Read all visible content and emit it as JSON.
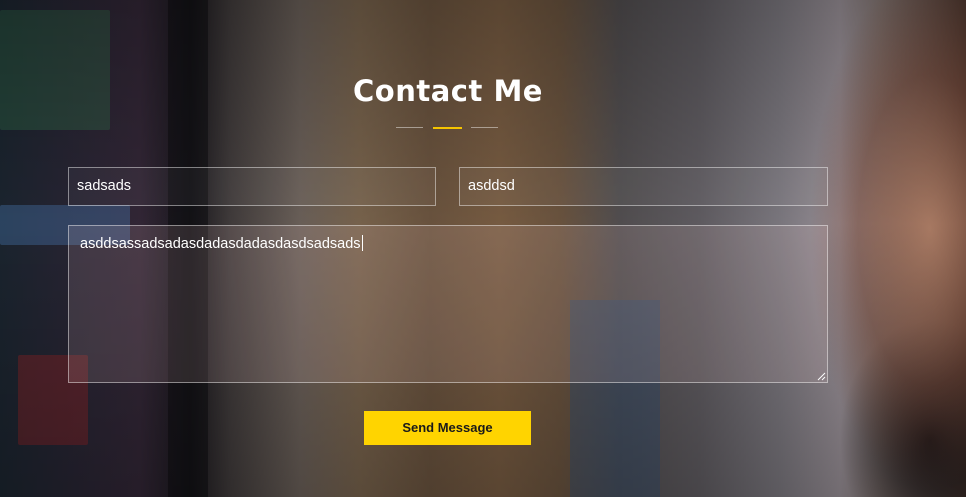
{
  "contact": {
    "title": "Contact Me",
    "name_value": "sadsads",
    "email_value": "asddsd",
    "message_value": "asddsassadsadasdadasdadasdasdsadsads",
    "send_label": "Send Message"
  },
  "colors": {
    "accent": "#ffd400",
    "title_text": "#ffffff",
    "field_border": "rgba(255,255,255,0.45)"
  }
}
